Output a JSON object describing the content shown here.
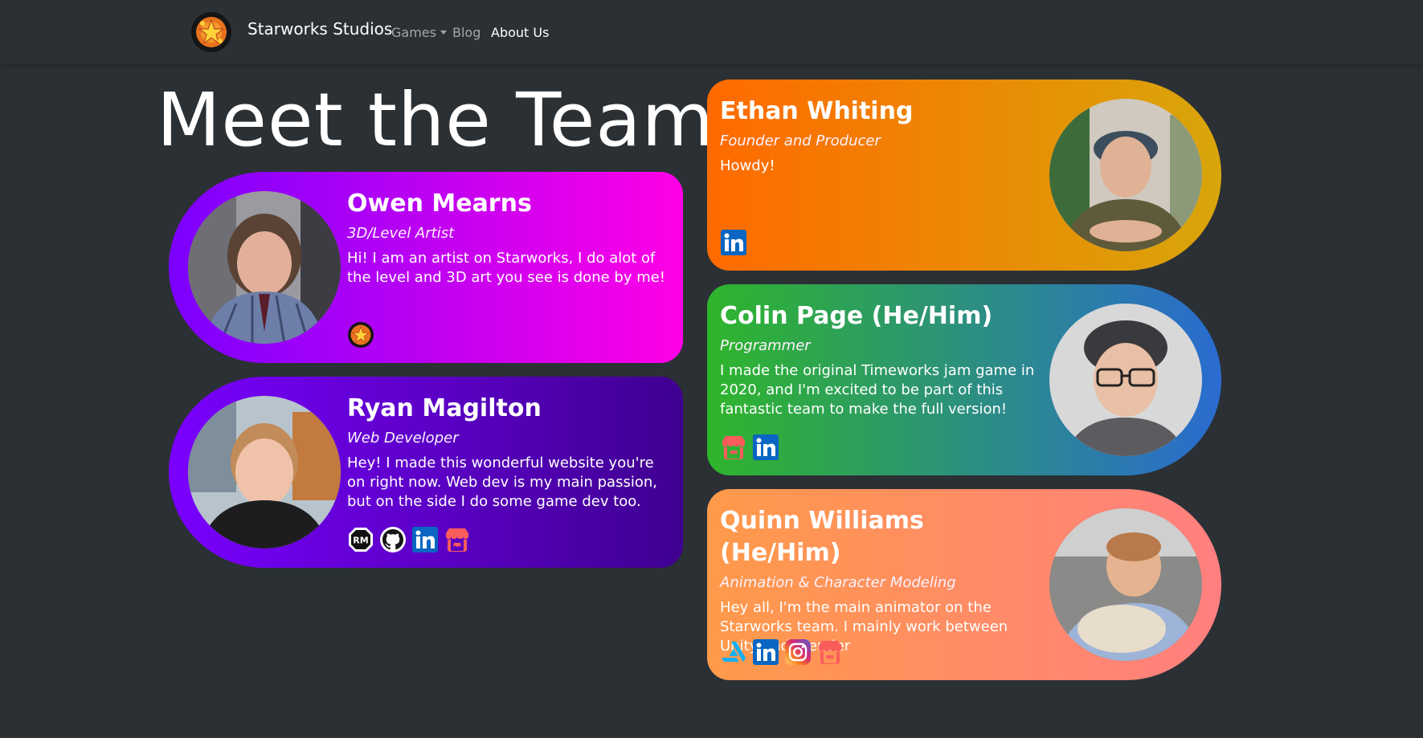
{
  "navbar": {
    "brand": "Starworks Studios",
    "items": [
      {
        "label": "Games"
      },
      {
        "label": "Blog"
      },
      {
        "label": "About Us"
      }
    ]
  },
  "page_title": "Meet the Team",
  "team": [
    {
      "name": "Owen Mearns",
      "role": "3D/Level Artist",
      "bio": "Hi! I am an artist on Starworks, I do alot of the level and 3D art you see is done by me!",
      "socials": [
        "starworks-icon"
      ],
      "gradient": [
        "#7b00ff",
        "#ff00e6"
      ]
    },
    {
      "name": "Ryan Magilton",
      "role": "Web Developer",
      "bio": "Hey! I made this wonderful website you're on right now. Web dev is my main passion, but on the side I do some game dev too.",
      "socials": [
        "rm-icon",
        "github-icon",
        "linkedin-icon",
        "itchio-icon"
      ],
      "gradient": [
        "#7a00ff",
        "#3f0090"
      ]
    },
    {
      "name": "Ethan Whiting",
      "role": "Founder and Producer",
      "bio": "Howdy!",
      "socials": [
        "linkedin-icon"
      ],
      "gradient": [
        "#ff6a00",
        "#d8a60a"
      ]
    },
    {
      "name": "Colin Page (He/Him)",
      "role": "Programmer",
      "bio": "I made the original Timeworks jam game in 2020, and I'm excited to be part of this fantastic team to make the full version!",
      "socials": [
        "itchio-icon",
        "linkedin-icon"
      ],
      "gradient": [
        "#2fb52b",
        "#2a6bd1"
      ]
    },
    {
      "name": "Quinn Williams (He/Him)",
      "role": "Animation & Character Modeling",
      "bio": "Hey all, I'm the main animator on the Starworks team. I mainly work between Unity and Blender",
      "socials": [
        "artstation-icon",
        "linkedin-icon",
        "instagram-icon",
        "itchio-icon"
      ],
      "gradient": [
        "#ff9a4a",
        "#ff7f7f"
      ]
    }
  ]
}
